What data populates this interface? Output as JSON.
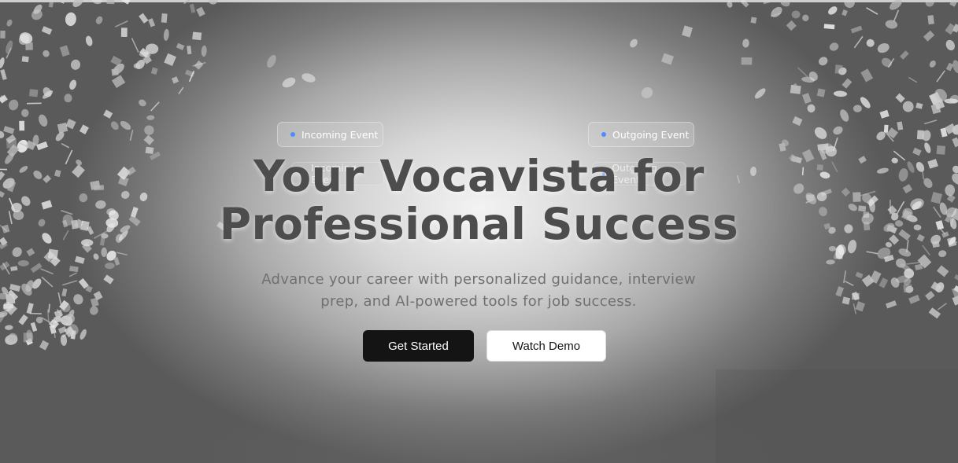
{
  "hero": {
    "title_line1": "Your Vocavista for",
    "title_line2": "Professional Success",
    "subtitle_line1": "Advance your career with personalized guidance, interview",
    "subtitle_line2": "prep, and AI-powered tools for job success."
  },
  "event_pills": {
    "incoming": "Incoming Event",
    "outgoing": "Outgoing Event",
    "incoming_ghost": "Incoming Event",
    "outgoing_ghost": "Outgoing Event"
  },
  "buttons": {
    "primary": "Get Started",
    "secondary": "Watch Demo"
  },
  "colors": {
    "event_dot": "#4c8dff",
    "primary_button_bg": "#141414",
    "secondary_button_bg": "#ffffff",
    "title_text": "#4d4d4d"
  }
}
